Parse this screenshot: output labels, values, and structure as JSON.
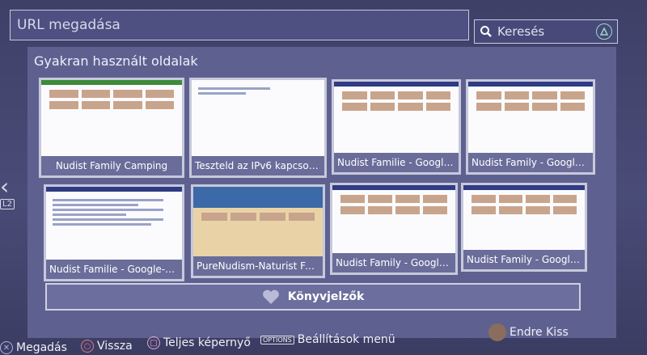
{
  "url_bar": {
    "placeholder": "URL megadása"
  },
  "search": {
    "label": "Keresés",
    "button_icon": "triangle-icon"
  },
  "section": {
    "title": "Gyakran használt oldalak"
  },
  "nav": {
    "left_icon": "chevron-left-icon",
    "l2_label": "L2"
  },
  "tiles": [
    {
      "caption": "Nudist Family Camping"
    },
    {
      "caption": "Teszteld az IPv6 kapcsolat..."
    },
    {
      "caption": "Nudist Familie - Google-k..."
    },
    {
      "caption": "Nudist Family - Google-ke..."
    },
    {
      "caption": "Nudist Familie - Google-k..."
    },
    {
      "caption": "PureNudism-Naturist Fam..."
    },
    {
      "caption": "Nudist Family - Google-ke..."
    },
    {
      "caption": "Nudist Family - Google-ke..."
    }
  ],
  "bookmarks": {
    "label": "Könyvjelzők",
    "icon": "heart-icon"
  },
  "footer": {
    "enter": "Megadás",
    "back": "Vissza",
    "fullscreen": "Teljes képernyő",
    "options_badge": "OPTIONS",
    "options": "Beállítások menü",
    "user": "Endre Kiss"
  },
  "colors": {
    "accent": "#5e6190",
    "background": "#3e4068"
  }
}
